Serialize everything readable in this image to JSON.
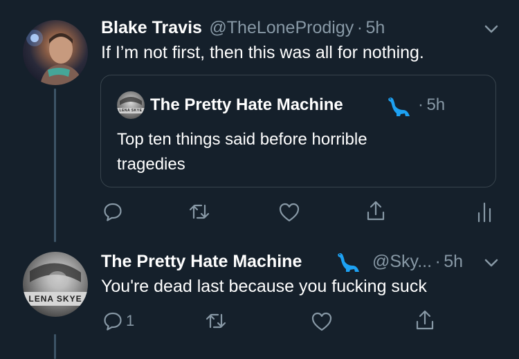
{
  "tweet1": {
    "display_name": "Blake Travis",
    "handle": "@TheLoneProdigy",
    "separator": "·",
    "time": "5h",
    "text": "If I’m not first, then this was all for nothing."
  },
  "quote": {
    "display_name": "The Pretty Hate Machine",
    "separator": "·",
    "time": "5h",
    "avatar_text": "LENA SKYE",
    "text_line1": "Top ten things said before horrible",
    "text_line2": "tragedies"
  },
  "tweet2": {
    "display_name": "The Pretty Hate Machine",
    "handle": "@Sky...",
    "separator": "·",
    "time": "5h",
    "avatar_text": "LENA SKYE",
    "text": "You're dead last because you fucking suck",
    "reply_count": "1"
  },
  "icons": {
    "reply": "speech-bubble",
    "retweet": "retweet-arrows",
    "like": "heart",
    "share": "share-upload",
    "analytics": "bar-chart",
    "caret": "chevron-down",
    "emoji": "dinosaur"
  },
  "colors": {
    "background": "#15202b",
    "secondary_text": "#8899a6",
    "border": "#38444d",
    "dino": "#1da1f2"
  }
}
